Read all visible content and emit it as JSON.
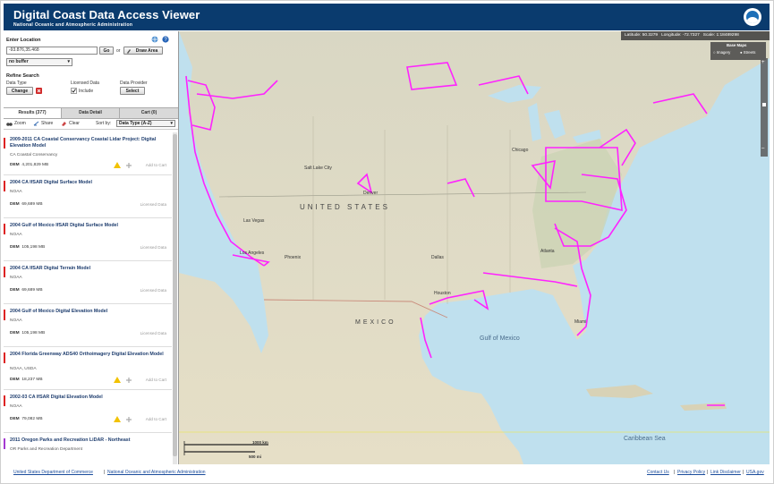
{
  "header": {
    "title": "Digital Coast Data Access Viewer",
    "subtitle": "National Oceanic and Atmospheric Administration"
  },
  "location": {
    "label": "Enter Location",
    "value": "-93.876,35.468",
    "go": "Go",
    "or": "or",
    "draw_area": "Draw Area",
    "buffer": "no buffer"
  },
  "refine": {
    "label": "Refine Search",
    "data_type": "Data Type",
    "licensed": "Licensed Data",
    "provider": "Data Provider",
    "change": "Change",
    "include": "Include",
    "select": "Select"
  },
  "tabs": {
    "results": "Results (377)",
    "detail": "Data Detail",
    "cart": "Cart (0)"
  },
  "toolbar": {
    "zoom": "Zoom",
    "share": "Share",
    "clear": "Clear",
    "sort_by": "Sort by:",
    "sort_value": "Data Type (A-Z)"
  },
  "results": [
    {
      "title": "2009-2011 CA Coastal Conservancy Coastal Lidar Project: Digital Elevation Model",
      "provider": "CA Coastal Conservancy",
      "type": "DEM",
      "size": "4,201,829 MB",
      "status": "Add to Cart",
      "warn": true
    },
    {
      "title": "2004 CA IfSAR Digital Surface Model",
      "provider": "NOAA",
      "type": "DEM",
      "size": "69,689 MB",
      "status": "Licensed Data",
      "warn": false
    },
    {
      "title": "2004 Gulf of Mexico IfSAR Digital Surface Model",
      "provider": "NOAA",
      "type": "DEM",
      "size": "105,198 MB",
      "status": "Licensed Data",
      "warn": false
    },
    {
      "title": "2004 CA IfSAR Digital Terrain Model",
      "provider": "NOAA",
      "type": "DEM",
      "size": "69,689 MB",
      "status": "Licensed Data",
      "warn": false
    },
    {
      "title": "2004 Gulf of Mexico Digital Elevation Model",
      "provider": "NOAA",
      "type": "DEM",
      "size": "105,198 MB",
      "status": "Licensed Data",
      "warn": false
    },
    {
      "title": "2004 Florida Greenway ADS40 Orthoimagery Digital Elevation Model",
      "provider": "NOAA, USDA",
      "type": "DEM",
      "size": "18,237 MB",
      "status": "Add to Cart",
      "warn": true
    },
    {
      "title": "2002-03 CA IfSAR Digital Elevation Model",
      "provider": "NOAA",
      "type": "DEM",
      "size": "79,082 MB",
      "status": "Add to Cart",
      "warn": true
    },
    {
      "title": "2011 Oregon Parks and Recreation LiDAR - Northeast",
      "provider": "OR Parks and Recreation Department",
      "type": "",
      "size": "",
      "status": "",
      "warn": false
    }
  ],
  "map": {
    "latitude_label": "Latitude",
    "latitude": "50.3279",
    "longitude_label": "Longitude",
    "longitude": "-72.7327",
    "scale_label": "Scale",
    "scale": "1:18489298",
    "basemaps": "Base Maps",
    "imagery": "Imagery",
    "streets": "Streets",
    "labels": {
      "us": "UNITED STATES",
      "mx": "MEXICO",
      "gulf": "Gulf of Mexico",
      "carib": "Caribbean Sea",
      "lv": "Las Vegas",
      "slc": "Salt Lake City",
      "den": "Denver",
      "dal": "Dallas",
      "mia": "Miami",
      "chi": "Chicago",
      "hou": "Houston",
      "la": "Los Angeles",
      "phx": "Phoenix",
      "atl": "Atlanta"
    },
    "scale_km": "1000 km",
    "scale_mi": "500 mi"
  },
  "footer": {
    "commerce": "United States Department of Commerce",
    "sep": "|",
    "noaa": "National Oceanic and Atmospheric Administration",
    "contact": "Contact Us",
    "privacy": "Privacy Policy",
    "disclaimer": "Link Disclaimer",
    "usa": "USA.gov"
  },
  "colors": {
    "header": "#0a3b6e",
    "coverage": "#ff22ff",
    "result_bar": "#dd2222"
  }
}
